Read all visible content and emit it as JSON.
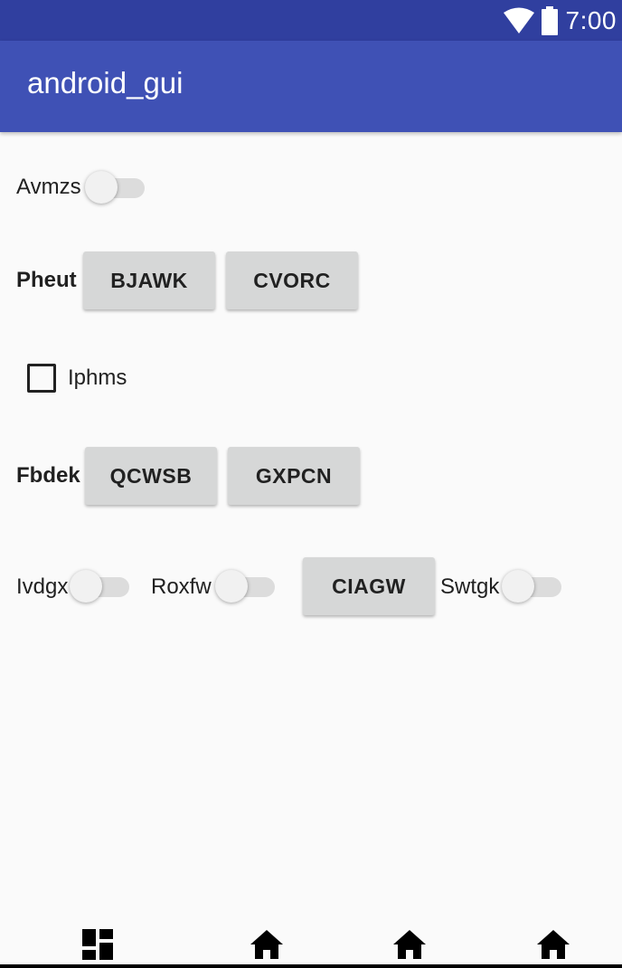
{
  "status_bar": {
    "time": "7:00",
    "icons": [
      "wifi-icon",
      "battery-icon"
    ]
  },
  "app_bar": {
    "title": "android_gui"
  },
  "rows": {
    "row1": {
      "label": "Avmzs",
      "switch_on": false
    },
    "row2": {
      "label": "Pheut",
      "buttons": [
        "BJAWK",
        "CVORC"
      ]
    },
    "row3": {
      "checkbox_label": "Iphms",
      "checked": false
    },
    "row4": {
      "label": "Fbdek",
      "buttons": [
        "QCWSB",
        "GXPCN"
      ]
    },
    "row5": {
      "switch1_label": "Ivdgx",
      "switch1_on": false,
      "switch2_label": "Roxfw",
      "switch2_on": false,
      "button": "CIAGW",
      "switch3_label": "Swtgk",
      "switch3_on": false
    }
  },
  "bottom_nav": {
    "icons": [
      "dashboard-icon",
      "home-icon",
      "home-icon",
      "home-icon"
    ]
  },
  "colors": {
    "status_bar": "#303f9f",
    "app_bar": "#3f51b5",
    "background": "#fafafa",
    "button": "#d6d7d7"
  }
}
